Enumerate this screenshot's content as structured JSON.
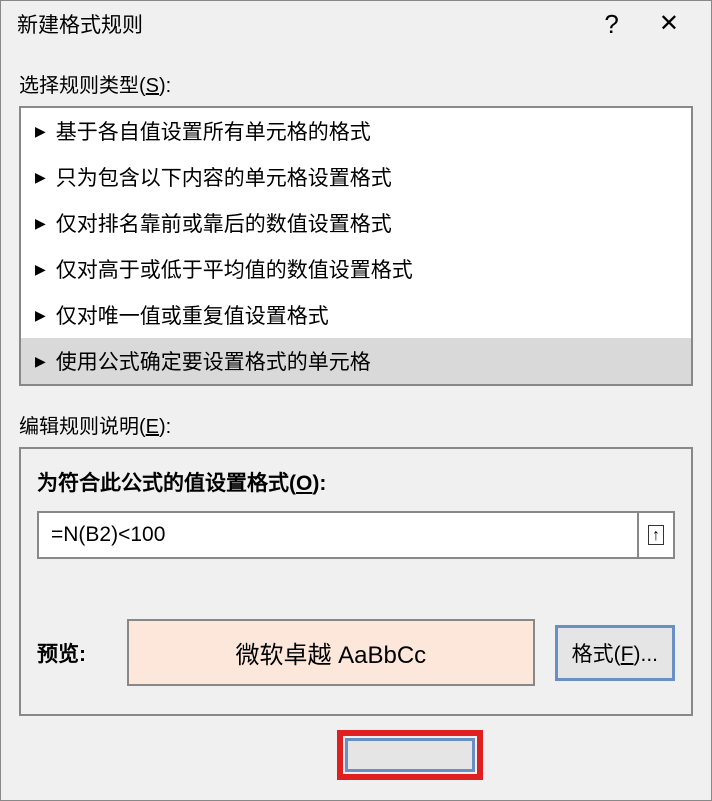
{
  "titlebar": {
    "title": "新建格式规则",
    "help": "?",
    "close": "✕"
  },
  "section": {
    "ruleType": {
      "label_pre": "选择规则类型(",
      "label_key": "S",
      "label_post": "):"
    },
    "items": [
      "基于各自值设置所有单元格的格式",
      "只为包含以下内容的单元格设置格式",
      "仅对排名靠前或靠后的数值设置格式",
      "仅对高于或低于平均值的数值设置格式",
      "仅对唯一值或重复值设置格式",
      "使用公式确定要设置格式的单元格"
    ]
  },
  "editRule": {
    "label_pre": "编辑规则说明(",
    "label_key": "E",
    "label_post": "):"
  },
  "formula": {
    "label_pre": "为符合此公式的值设置格式(",
    "label_key": "O",
    "label_post": "):",
    "value": "=N(B2)<100"
  },
  "preview": {
    "label": "预览:",
    "text": "微软卓越 AaBbCc"
  },
  "formatBtn": {
    "pre": "格式(",
    "key": "F",
    "post": ")..."
  }
}
